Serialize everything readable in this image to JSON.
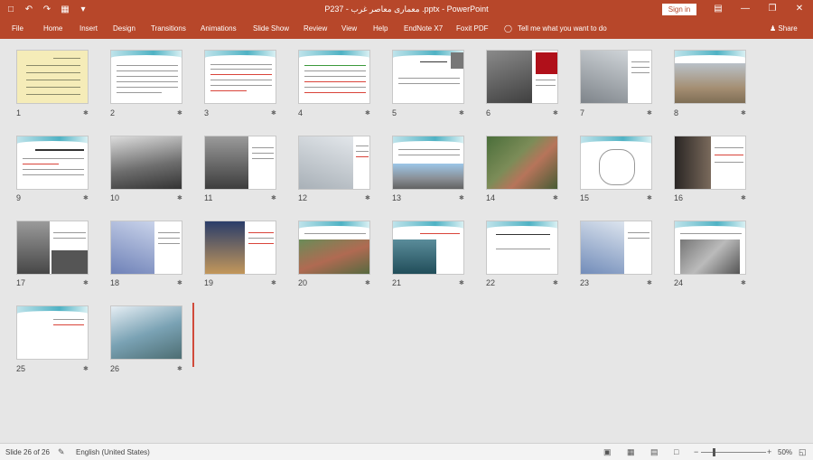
{
  "titlebar": {
    "title": "P237 - معماری معاصر غرب .pptx - PowerPoint",
    "signin": "Sign in",
    "qat_icons": [
      "save-icon",
      "undo-icon",
      "redo-icon",
      "present-icon",
      "customize-icon"
    ],
    "window_controls": [
      "ribbon-display-icon",
      "minimize-icon",
      "restore-icon",
      "close-icon"
    ]
  },
  "ribbon": {
    "tabs": [
      "File",
      "Home",
      "Insert",
      "Design",
      "Transitions",
      "Animations",
      "Slide Show",
      "Review",
      "View",
      "Help",
      "EndNote X7",
      "Foxit PDF"
    ],
    "tell_me": "Tell me what you want to do",
    "share": "Share"
  },
  "slides": [
    {
      "n": "1"
    },
    {
      "n": "2"
    },
    {
      "n": "3"
    },
    {
      "n": "4"
    },
    {
      "n": "5"
    },
    {
      "n": "6"
    },
    {
      "n": "7"
    },
    {
      "n": "8"
    },
    {
      "n": "9"
    },
    {
      "n": "10"
    },
    {
      "n": "11"
    },
    {
      "n": "12"
    },
    {
      "n": "13"
    },
    {
      "n": "14"
    },
    {
      "n": "15"
    },
    {
      "n": "16"
    },
    {
      "n": "17"
    },
    {
      "n": "18"
    },
    {
      "n": "19"
    },
    {
      "n": "20"
    },
    {
      "n": "21"
    },
    {
      "n": "22"
    },
    {
      "n": "23"
    },
    {
      "n": "24"
    },
    {
      "n": "25"
    },
    {
      "n": "26"
    }
  ],
  "status": {
    "slide_of": "Slide 26 of 26",
    "language": "English (United States)",
    "zoom": "50%"
  }
}
